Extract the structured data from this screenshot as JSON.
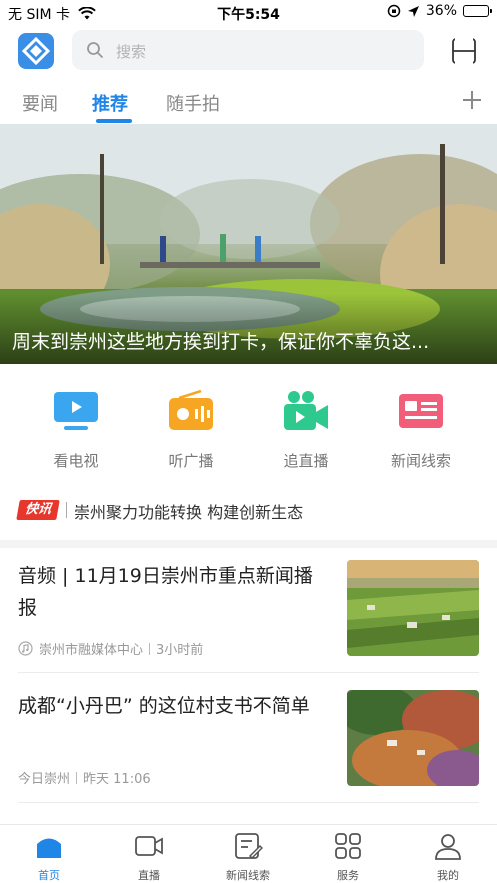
{
  "status_bar": {
    "carrier": "无 SIM 卡",
    "time": "下午5:54",
    "battery": "36%",
    "battery_level": 0.36
  },
  "header": {
    "search_placeholder": "搜索"
  },
  "tabs": [
    {
      "label": "要闻",
      "active": false
    },
    {
      "label": "推荐",
      "active": true
    },
    {
      "label": "随手拍",
      "active": false
    }
  ],
  "banner": {
    "caption": "周末到崇州这些地方挨到打卡，保证你不辜负这..."
  },
  "quick_links": [
    {
      "label": "看电视",
      "icon": "tv-icon",
      "color": "#3aa6f0"
    },
    {
      "label": "听广播",
      "icon": "radio-icon",
      "color": "#f7a623"
    },
    {
      "label": "追直播",
      "icon": "live-camera-icon",
      "color": "#2ec98e"
    },
    {
      "label": "新闻线索",
      "icon": "news-clue-icon",
      "color": "#f25d7a"
    }
  ],
  "flash": {
    "tag": "快讯",
    "text": "崇州聚力功能转换 构建创新生态"
  },
  "news": [
    {
      "title": "音频 | 11月19日崇州市重点新闻播报",
      "source": "崇州市融媒体中心",
      "time": "3小时前",
      "has_audio_icon": true
    },
    {
      "title": "成都“小丹巴” 的这位村支书不简单",
      "source": "今日崇州",
      "time": "昨天 11:06",
      "has_audio_icon": false
    }
  ],
  "bottom_nav": [
    {
      "label": "首页",
      "icon": "home-icon",
      "active": true
    },
    {
      "label": "直播",
      "icon": "video-icon",
      "active": false
    },
    {
      "label": "新闻线索",
      "icon": "edit-note-icon",
      "active": false
    },
    {
      "label": "服务",
      "icon": "grid-icon",
      "active": false
    },
    {
      "label": "我的",
      "icon": "user-icon",
      "active": false
    }
  ],
  "colors": {
    "accent": "#1f86e8",
    "flash_red": "#e7362b"
  }
}
